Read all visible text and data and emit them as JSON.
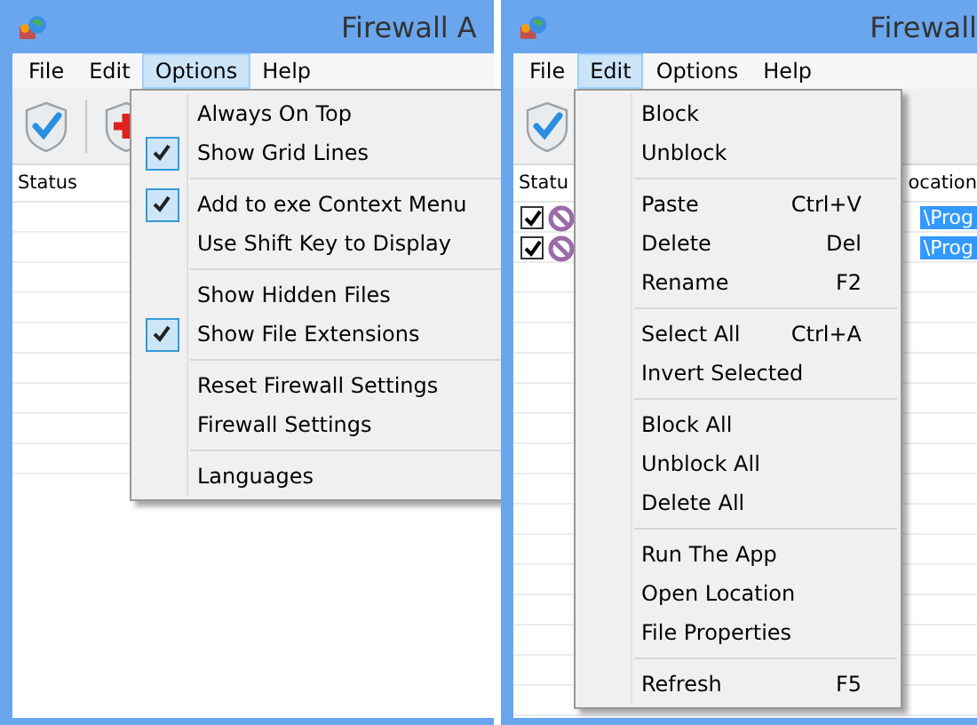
{
  "windows": [
    {
      "title": "Firewall A",
      "menubar": [
        {
          "label": "File",
          "selected": false
        },
        {
          "label": "Edit",
          "selected": false
        },
        {
          "label": "Options",
          "selected": true
        },
        {
          "label": "Help",
          "selected": false
        }
      ],
      "toolbar": [
        {
          "kind": "allow"
        },
        {
          "kind": "block"
        }
      ],
      "columns": [
        "Status"
      ],
      "menu": {
        "items": [
          {
            "kind": "item",
            "label": "Always On Top",
            "checked": false
          },
          {
            "kind": "item",
            "label": "Show Grid Lines",
            "checked": true
          },
          {
            "kind": "separator"
          },
          {
            "kind": "item",
            "label": "Add to exe Context Menu",
            "checked": true
          },
          {
            "kind": "item",
            "label": "Use Shift Key to Display",
            "checked": false
          },
          {
            "kind": "separator"
          },
          {
            "kind": "item",
            "label": "Show Hidden Files",
            "checked": false
          },
          {
            "kind": "item",
            "label": "Show File Extensions",
            "checked": true
          },
          {
            "kind": "separator"
          },
          {
            "kind": "item",
            "label": "Reset Firewall Settings",
            "checked": false
          },
          {
            "kind": "item",
            "label": "Firewall Settings",
            "checked": false
          },
          {
            "kind": "separator"
          },
          {
            "kind": "item",
            "label": "Languages",
            "checked": false
          }
        ]
      }
    },
    {
      "title": "Firewall",
      "menubar": [
        {
          "label": "File",
          "selected": false
        },
        {
          "label": "Edit",
          "selected": true
        },
        {
          "label": "Options",
          "selected": false
        },
        {
          "label": "Help",
          "selected": false
        }
      ],
      "toolbar": [
        {
          "kind": "allow"
        }
      ],
      "columns": [
        "Statu",
        "ocation"
      ],
      "rows": [
        {
          "checked": true,
          "location": "\\Prog",
          "selected": true
        },
        {
          "checked": true,
          "location": "\\Prog",
          "selected": true
        }
      ],
      "menu": {
        "items": [
          {
            "kind": "item",
            "label": "Block"
          },
          {
            "kind": "item",
            "label": "Unblock"
          },
          {
            "kind": "separator"
          },
          {
            "kind": "item",
            "label": "Paste",
            "shortcut": "Ctrl+V"
          },
          {
            "kind": "item",
            "label": "Delete",
            "shortcut": "Del"
          },
          {
            "kind": "item",
            "label": "Rename",
            "shortcut": "F2"
          },
          {
            "kind": "separator"
          },
          {
            "kind": "item",
            "label": "Select All",
            "shortcut": "Ctrl+A"
          },
          {
            "kind": "item",
            "label": "Invert Selected"
          },
          {
            "kind": "separator"
          },
          {
            "kind": "item",
            "label": "Block All"
          },
          {
            "kind": "item",
            "label": "Unblock All"
          },
          {
            "kind": "item",
            "label": "Delete All"
          },
          {
            "kind": "separator"
          },
          {
            "kind": "item",
            "label": "Run The App"
          },
          {
            "kind": "item",
            "label": "Open Location"
          },
          {
            "kind": "item",
            "label": "File Properties"
          },
          {
            "kind": "separator"
          },
          {
            "kind": "item",
            "label": "Refresh",
            "shortcut": "F5"
          }
        ]
      }
    }
  ]
}
